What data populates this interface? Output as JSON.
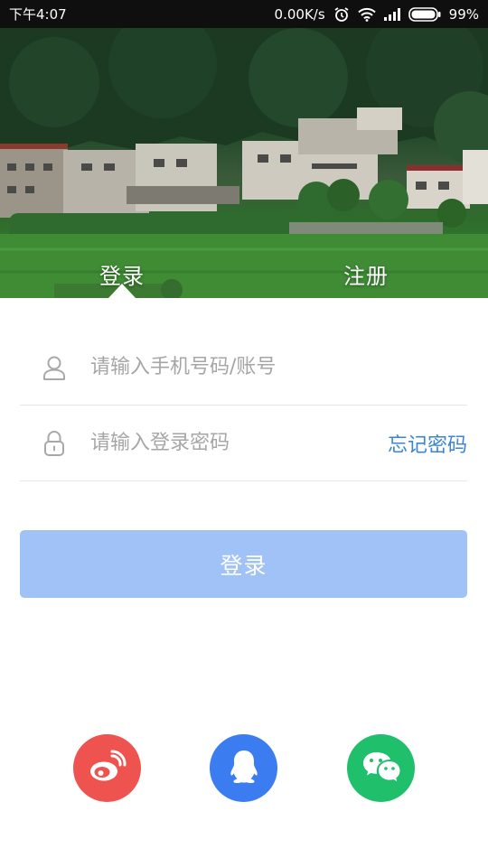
{
  "status_bar": {
    "time": "下午4:07",
    "network_speed": "0.00K/s",
    "battery": "99%",
    "icons": [
      "alarm-icon",
      "wifi-icon",
      "signal-icon",
      "battery-icon"
    ]
  },
  "tabs": [
    {
      "label": "登录",
      "selected": true
    },
    {
      "label": "注册",
      "selected": false
    }
  ],
  "account_field": {
    "placeholder": "请输入手机号码/账号",
    "value": "",
    "icon": "user-icon"
  },
  "password_field": {
    "placeholder": "请输入登录密码",
    "value": "",
    "icon": "lock-icon"
  },
  "forgot_password_label": "忘记密码",
  "login_button_label": "登录",
  "social_logins": [
    {
      "icon": "weibo-icon",
      "color": "#ef5350"
    },
    {
      "icon": "qq-icon",
      "color": "#3b7cf0"
    },
    {
      "icon": "wechat-icon",
      "color": "#1fbf6b"
    }
  ],
  "colors": {
    "accent": "#3a86d4",
    "login_button": "#a0c2f7",
    "status_bar": "#0f0f0f"
  }
}
